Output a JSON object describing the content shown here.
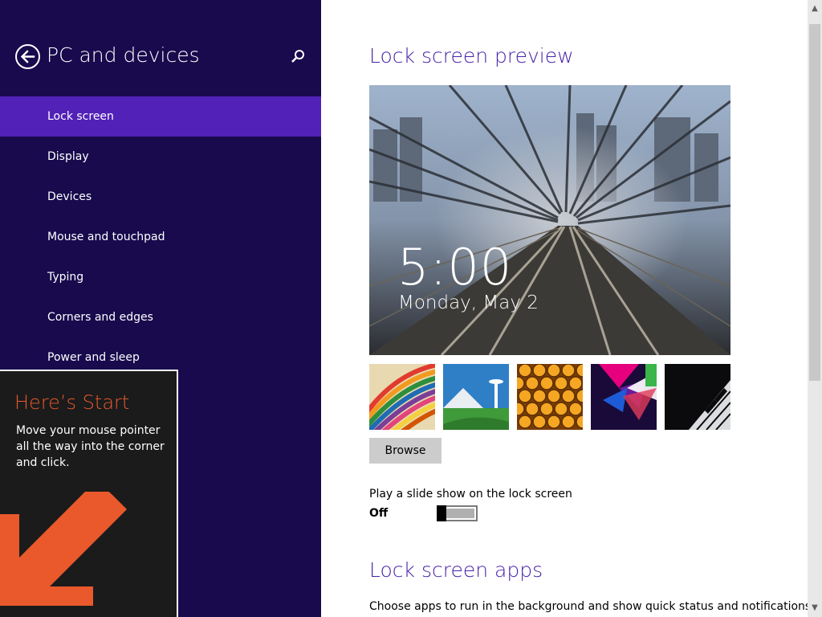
{
  "nav": {
    "title": "PC and devices",
    "back_icon": "back-arrow-icon",
    "search_icon": "search-icon",
    "items": [
      {
        "label": "Lock screen",
        "active": true
      },
      {
        "label": "Display"
      },
      {
        "label": "Devices"
      },
      {
        "label": "Mouse and touchpad"
      },
      {
        "label": "Typing"
      },
      {
        "label": "Corners and edges"
      },
      {
        "label": "Power and sleep"
      }
    ]
  },
  "tip": {
    "title": "Here’s Start",
    "body": "Move your mouse pointer all the way into the corner and click."
  },
  "lock_screen": {
    "preview_title": "Lock screen preview",
    "time": "5:00",
    "date": "Monday, May 2",
    "thumbnails": [
      "colorful-stripes",
      "mountain-city",
      "honeycomb",
      "geometric-shapes",
      "piano-keys"
    ],
    "browse_label": "Browse",
    "slideshow_label": "Play a slide show on the lock screen",
    "slideshow_state": "Off",
    "slideshow_on": false
  },
  "apps": {
    "title": "Lock screen apps",
    "description": "Choose apps to run in the background and show quick status and notifications,"
  },
  "colors": {
    "nav_bg": "#180a4d",
    "nav_active": "#5221b7",
    "heading": "#4723a8",
    "tip_accent": "#e9592c"
  }
}
